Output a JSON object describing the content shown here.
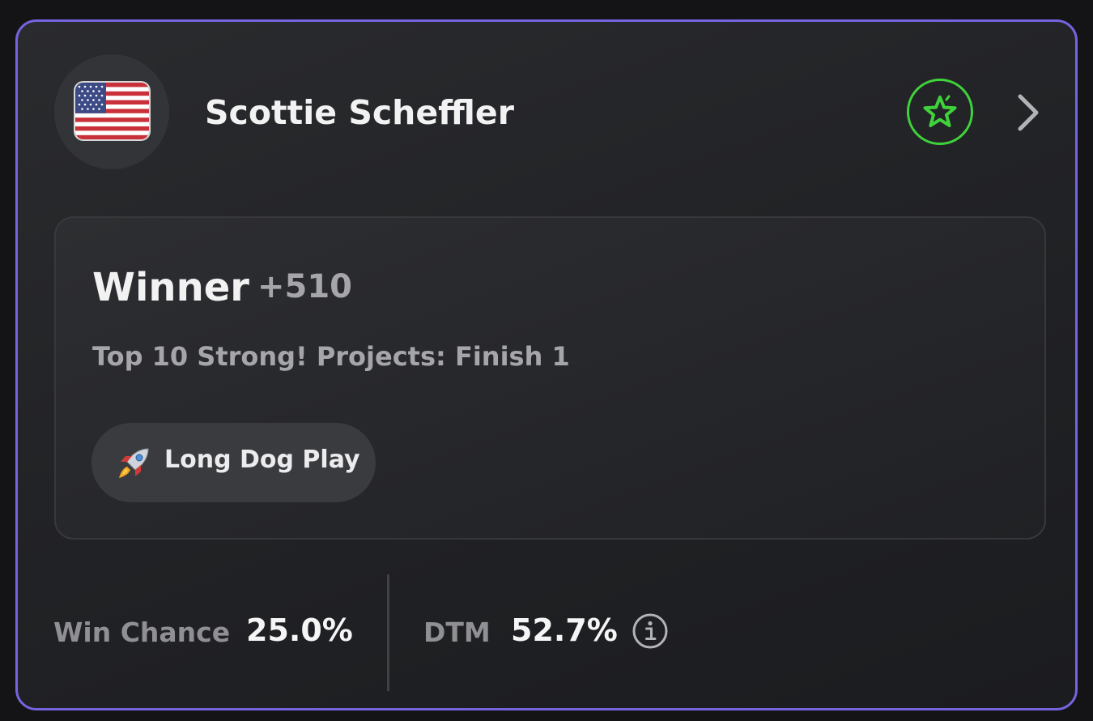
{
  "player": {
    "name": "Scottie Scheffler",
    "country_flag_icon": "us-flag-icon"
  },
  "actions": {
    "favorite_icon": "star-icon",
    "favorite_color": "#3fd33b",
    "open_icon": "chevron-right-icon"
  },
  "bet": {
    "market": "Winner",
    "odds": "+510",
    "projection": "Top 10 Strong! Projects: Finish 1",
    "tag": {
      "icon": "rocket-icon",
      "label": "Long Dog Play"
    }
  },
  "stats": {
    "win_chance": {
      "label": "Win Chance",
      "value": "25.0%"
    },
    "dtm": {
      "label": "DTM",
      "value": "52.7%",
      "info_icon": "info-icon"
    }
  },
  "colors": {
    "card_border": "#7564e0",
    "accent_green": "#3fd33b"
  }
}
